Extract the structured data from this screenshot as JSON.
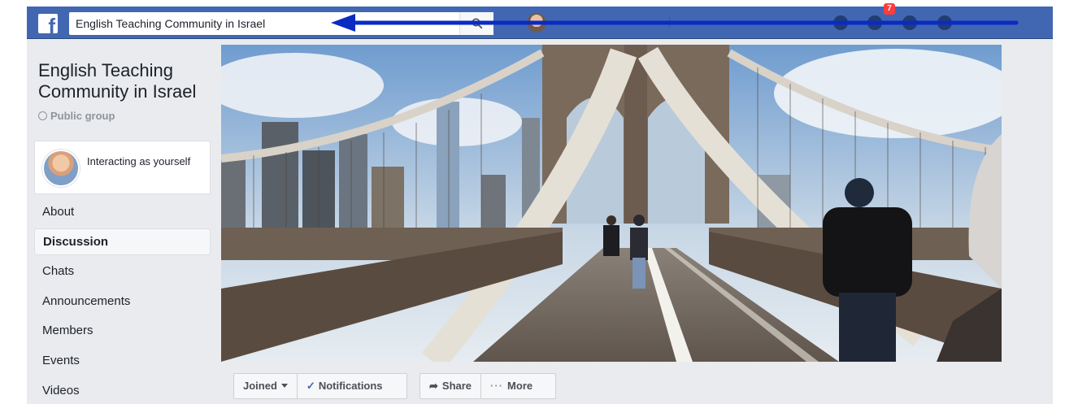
{
  "topbar": {
    "search_value": "English Teaching Community in Israel",
    "notification_count": "7"
  },
  "sidebar": {
    "group_name": "English Teaching Community in Israel",
    "privacy": "Public group",
    "interacting_as": "Interacting as yourself",
    "menu": [
      {
        "label": "About"
      },
      {
        "label": "Discussion"
      },
      {
        "label": "Chats"
      },
      {
        "label": "Announcements"
      },
      {
        "label": "Members"
      },
      {
        "label": "Events"
      },
      {
        "label": "Videos"
      }
    ]
  },
  "actions": {
    "joined": "Joined",
    "notifications": "Notifications",
    "share": "Share",
    "more": "More"
  },
  "colors": {
    "nav": "#4267b2",
    "background": "#e9ebee",
    "annotation_arrow": "#0a2bc2",
    "badge": "#fa3e3e"
  }
}
